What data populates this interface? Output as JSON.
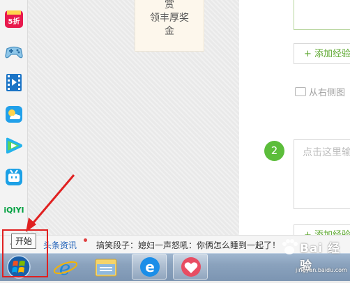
{
  "dock": {
    "items": [
      {
        "name": "5zhe-app-icon",
        "badge": "5折"
      },
      {
        "name": "game-controller-icon"
      },
      {
        "name": "video-player-icon"
      },
      {
        "name": "weather-icon"
      },
      {
        "name": "tencent-video-icon"
      },
      {
        "name": "bilibili-icon"
      },
      {
        "name": "iqiyi-icon",
        "label": "iQIYI"
      }
    ]
  },
  "reward_card": {
    "line1": "赏",
    "line2": "领丰厚奖",
    "line3": "金"
  },
  "editor": {
    "add_step_label_top": "+ 添加经验",
    "image_hint": "从右侧图",
    "step_number": "2",
    "step_placeholder": "点击这里输",
    "add_step_label_bottom": "+ 添加经验"
  },
  "ticker": {
    "source": "头条资讯",
    "headline": "搞笑段子：媳妇一声怒吼：你俩怎么睡到一起了！"
  },
  "tooltip": {
    "text": "开始"
  },
  "taskbar": {
    "items": [
      {
        "name": "start-button"
      },
      {
        "name": "internet-explorer-icon"
      },
      {
        "name": "file-explorer-icon"
      },
      {
        "name": "browser-e-icon"
      },
      {
        "name": "heart-app-icon"
      }
    ]
  },
  "watermark": {
    "brand": "Bai 经验",
    "url": "jingyan.baidu.com"
  },
  "colors": {
    "accent_green": "#5cbd3b",
    "annotation_red": "#e02020",
    "link_blue": "#1d5fb8"
  }
}
